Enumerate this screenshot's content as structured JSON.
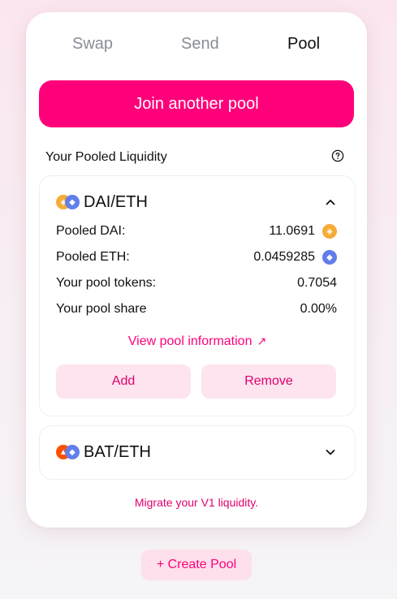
{
  "tabs": [
    {
      "label": "Swap",
      "active": false
    },
    {
      "label": "Send",
      "active": false
    },
    {
      "label": "Pool",
      "active": true
    }
  ],
  "join_button": "Join another pool",
  "pooled_liquidity": {
    "title": "Your Pooled Liquidity",
    "help_icon": "question-circle-icon"
  },
  "pools": [
    {
      "pair": "DAI/ETH",
      "expanded": true,
      "tokens": [
        {
          "symbol": "DAI",
          "icon": "dai-coin-icon",
          "color": "#f5ac37"
        },
        {
          "symbol": "ETH",
          "icon": "eth-coin-icon",
          "color": "#627eea"
        }
      ],
      "stats": [
        {
          "label": "Pooled DAI:",
          "value": "11.0691",
          "icon": "dai-coin-icon"
        },
        {
          "label": "Pooled ETH:",
          "value": "0.0459285",
          "icon": "eth-coin-icon"
        },
        {
          "label": "Your pool tokens:",
          "value": "0.7054"
        },
        {
          "label": "Your pool share",
          "value": "0.00%"
        }
      ],
      "view_link": "View pool information",
      "view_link_icon": "arrow-up-right-icon",
      "add_label": "Add",
      "remove_label": "Remove"
    },
    {
      "pair": "BAT/ETH",
      "expanded": false,
      "tokens": [
        {
          "symbol": "BAT",
          "icon": "bat-coin-icon",
          "color": "#ff5000"
        },
        {
          "symbol": "ETH",
          "icon": "eth-coin-icon",
          "color": "#627eea"
        }
      ]
    }
  ],
  "migrate_link": "Migrate your V1 liquidity.",
  "create_pool": "+ Create Pool",
  "colors": {
    "accent": "#ff007a",
    "accent_soft": "#fde4ef",
    "text": "#101014",
    "muted": "#8a8d96"
  }
}
